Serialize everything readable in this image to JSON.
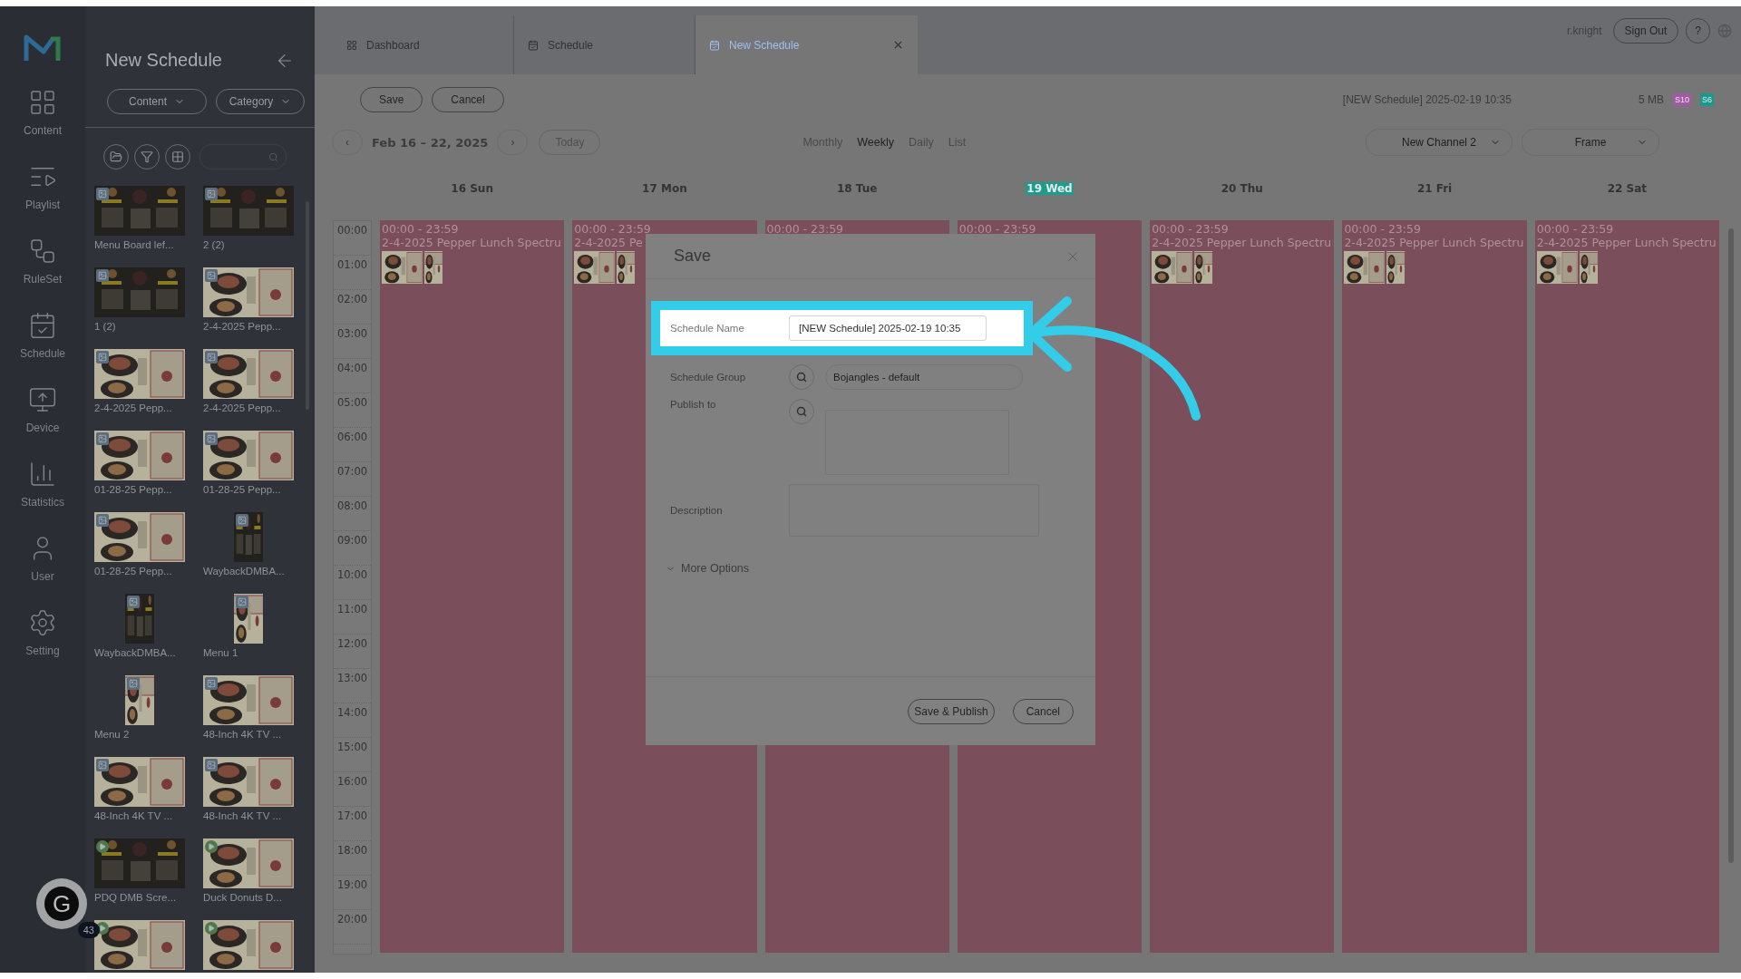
{
  "nav": {
    "items": [
      {
        "label": "Content"
      },
      {
        "label": "Playlist"
      },
      {
        "label": "RuleSet"
      },
      {
        "label": "Schedule"
      },
      {
        "label": "Device"
      },
      {
        "label": "Statistics"
      },
      {
        "label": "User"
      },
      {
        "label": "Setting"
      }
    ]
  },
  "widget": {
    "logo": "G",
    "badge": "43"
  },
  "library": {
    "title": "New Schedule",
    "filters": [
      "Content",
      "Category"
    ],
    "items": [
      {
        "name": "Menu Board lef...",
        "kind": "darkmenu"
      },
      {
        "name": "2 (2)",
        "kind": "darkmenu"
      },
      {
        "name": "1 (2)",
        "kind": "darkmenu"
      },
      {
        "name": "2-4-2025 Pepp...",
        "kind": "lightmenu"
      },
      {
        "name": "2-4-2025 Pepp...",
        "kind": "lightmenu"
      },
      {
        "name": "2-4-2025 Pepp...",
        "kind": "lightmenu"
      },
      {
        "name": "01-28-25 Pepp...",
        "kind": "lightmenu"
      },
      {
        "name": "01-28-25 Pepp...",
        "kind": "lightmenu"
      },
      {
        "name": "01-28-25 Pepp...",
        "kind": "lightmenu"
      },
      {
        "name": "WaybackDMBA...",
        "kind": "darkposter"
      },
      {
        "name": "WaybackDMBA...",
        "kind": "darkposter"
      },
      {
        "name": "Menu 1",
        "kind": "lightposter"
      },
      {
        "name": "Menu 2",
        "kind": "lightposter"
      },
      {
        "name": "48-Inch 4K TV ...",
        "kind": "lightmenu"
      },
      {
        "name": "48-Inch 4K TV ...",
        "kind": "lightmenu"
      },
      {
        "name": "48-Inch 4K TV ...",
        "kind": "lightmenu"
      },
      {
        "name": "PDQ DMB Scre...",
        "kind": "darkvideo"
      },
      {
        "name": "Duck Donuts D...",
        "kind": "lightvideo"
      },
      {
        "kind": "lightvideo"
      },
      {
        "kind": "lightvideo"
      }
    ]
  },
  "tabs": [
    {
      "label": "Dashboard",
      "selected": false,
      "closable": false
    },
    {
      "label": "Schedule",
      "selected": false,
      "closable": false
    },
    {
      "label": "New Schedule",
      "selected": true,
      "closable": true
    }
  ],
  "user": {
    "name": "r.knight",
    "sign_out": "Sign Out",
    "help": "?"
  },
  "toolbar": {
    "buttons": [
      "Save",
      "Cancel"
    ],
    "schedule_name": "[NEW Schedule] 2025-02-19 10:35",
    "size": "5 MB",
    "badges": [
      {
        "label": "S10",
        "color": "#a35aa3"
      },
      {
        "label": "S6",
        "color": "#1a9a8c"
      }
    ]
  },
  "date_nav": {
    "prev": "‹",
    "range": "Feb 16 – 22, 2025",
    "next": "›",
    "today": "Today",
    "today_disabled": true
  },
  "views": [
    {
      "label": "Monthly",
      "selected": false
    },
    {
      "label": "Weekly",
      "selected": true
    },
    {
      "label": "Daily",
      "selected": false
    },
    {
      "label": "List",
      "selected": false
    }
  ],
  "selects": [
    {
      "value": "New Channel 2"
    },
    {
      "value": "Frame"
    }
  ],
  "calendar": {
    "days": [
      {
        "label": "16 Sun",
        "today": false,
        "event": {
          "time": "00:00 - 23:59",
          "title": "2-4-2025 Pepper Lunch Spectru",
          "thumbnails": true
        }
      },
      {
        "label": "17 Mon",
        "today": false,
        "event": {
          "time": "00:00 - 23:59",
          "title": "2-4-2025 Pe",
          "thumbnails": true
        }
      },
      {
        "label": "18 Tue",
        "today": false,
        "event": {
          "time": "00:00 - 23:59"
        }
      },
      {
        "label": "19 Wed",
        "today": true,
        "event": {
          "time": "00:00 - 23:59"
        }
      },
      {
        "label": "20 Thu",
        "today": false,
        "event": {
          "time": "00:00 - 23:59",
          "title": "2-4-2025 Pepper Lunch Spectru",
          "thumbnails": true
        }
      },
      {
        "label": "21 Fri",
        "today": false,
        "event": {
          "time": "00:00 - 23:59",
          "title": "2-4-2025 Pepper Lunch Spectru",
          "thumbnails": true
        }
      },
      {
        "label": "22 Sat",
        "today": false,
        "event": {
          "time": "00:00 - 23:59",
          "title": "2-4-2025 Pepper Lunch Spectru",
          "thumbnails": true
        }
      }
    ],
    "hours": [
      "00:00",
      "01:00",
      "02:00",
      "03:00",
      "04:00",
      "05:00",
      "06:00",
      "07:00",
      "08:00",
      "09:00",
      "10:00",
      "11:00",
      "12:00",
      "13:00",
      "14:00",
      "15:00",
      "16:00",
      "17:00",
      "18:00",
      "19:00",
      "20:00"
    ]
  },
  "dialog": {
    "title": "Save",
    "fields": [
      {
        "kind": "text",
        "label": "Schedule Name",
        "value": "[NEW Schedule] 2025-02-19 10:35",
        "highlighted": true
      },
      {
        "kind": "lookup",
        "label": "Schedule Group",
        "value": "Bojangles - default",
        "highlighted": false
      },
      {
        "kind": "lookuplist",
        "label": "Publish to",
        "highlighted": false
      },
      {
        "kind": "textarea",
        "label": "Description",
        "highlighted": false
      }
    ],
    "more_options": {
      "label": "More Options",
      "expanded": false
    },
    "buttons": [
      "Save & Publish",
      "Cancel"
    ]
  }
}
